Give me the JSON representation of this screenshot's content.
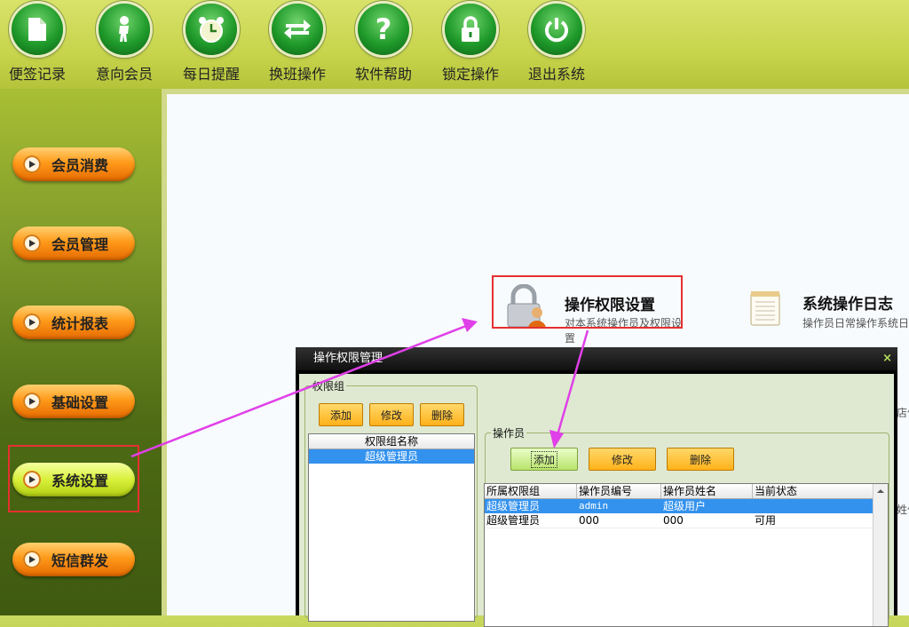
{
  "toolbar": {
    "items": [
      {
        "label": "便签记录",
        "icon": "document-icon"
      },
      {
        "label": "意向会员",
        "icon": "person-icon"
      },
      {
        "label": "每日提醒",
        "icon": "alarm-clock-icon"
      },
      {
        "label": "换班操作",
        "icon": "swap-arrows-icon"
      },
      {
        "label": "软件帮助",
        "icon": "question-icon"
      },
      {
        "label": "锁定操作",
        "icon": "lock-icon"
      },
      {
        "label": "退出系统",
        "icon": "power-icon"
      }
    ]
  },
  "sidebar": {
    "items": [
      {
        "label": "会员消费"
      },
      {
        "label": "会员管理"
      },
      {
        "label": "统计报表"
      },
      {
        "label": "基础设置"
      },
      {
        "label": "系统设置"
      },
      {
        "label": "短信群发"
      }
    ],
    "active": "系统设置"
  },
  "modules": {
    "permission": {
      "title": "操作权限设置",
      "desc": "对本系统操作员及权限设置"
    },
    "log": {
      "title": "系统操作日志",
      "desc": "操作员日常操作系统日"
    }
  },
  "edge_text": {
    "a": "店信",
    "b": "姓付"
  },
  "dialog": {
    "title": "操作权限管理",
    "close": "×",
    "group_panel": {
      "legend": "权限组",
      "add": "添加",
      "edit": "修改",
      "delete": "删除",
      "header": "权限组名称",
      "rows": [
        "超级管理员"
      ]
    },
    "operator_panel": {
      "legend": "操作员",
      "add": "添加",
      "edit": "修改",
      "delete": "删除",
      "columns": [
        "所属权限组",
        "操作员编号",
        "操作员姓名",
        "当前状态"
      ],
      "rows": [
        [
          "超级管理员",
          "admin",
          "超级用户",
          ""
        ],
        [
          "超级管理员",
          "000",
          "000",
          "可用"
        ]
      ]
    }
  },
  "colors": {
    "accent": "#3392ee",
    "annotation": "#e53030",
    "arrow": "#e040e8"
  }
}
